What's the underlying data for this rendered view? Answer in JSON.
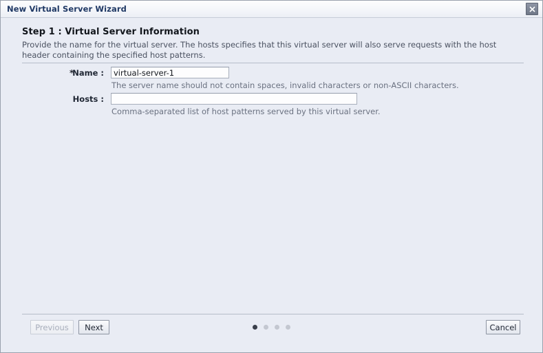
{
  "window": {
    "title": "New Virtual Server Wizard",
    "close_icon": "close-icon"
  },
  "step": {
    "title": "Step 1 : Virtual Server Information",
    "description": "Provide the name for the virtual server. The hosts specifies that this virtual server will also serve requests with the host header containing the specified host patterns."
  },
  "form": {
    "name_field": {
      "required_marker": "*",
      "label": "Name :",
      "value": "virtual-server-1",
      "placeholder": "",
      "hint": "The server name should not contain spaces, invalid characters or non-ASCII characters."
    },
    "hosts_field": {
      "label": "Hosts :",
      "value": "",
      "placeholder": "",
      "hint": "Comma-separated list of host patterns served by this virtual server."
    }
  },
  "footer": {
    "previous_label": "Previous",
    "next_label": "Next",
    "cancel_label": "Cancel",
    "steps_total": 4,
    "current_step": 1
  },
  "colors": {
    "title_text": "#1f3864",
    "body_background": "#e9ecf4",
    "divider": "#b6bcc9",
    "hint_text": "#6a7180",
    "active_dot": "#3a3f4b",
    "inactive_dot": "#c3c7d0"
  }
}
